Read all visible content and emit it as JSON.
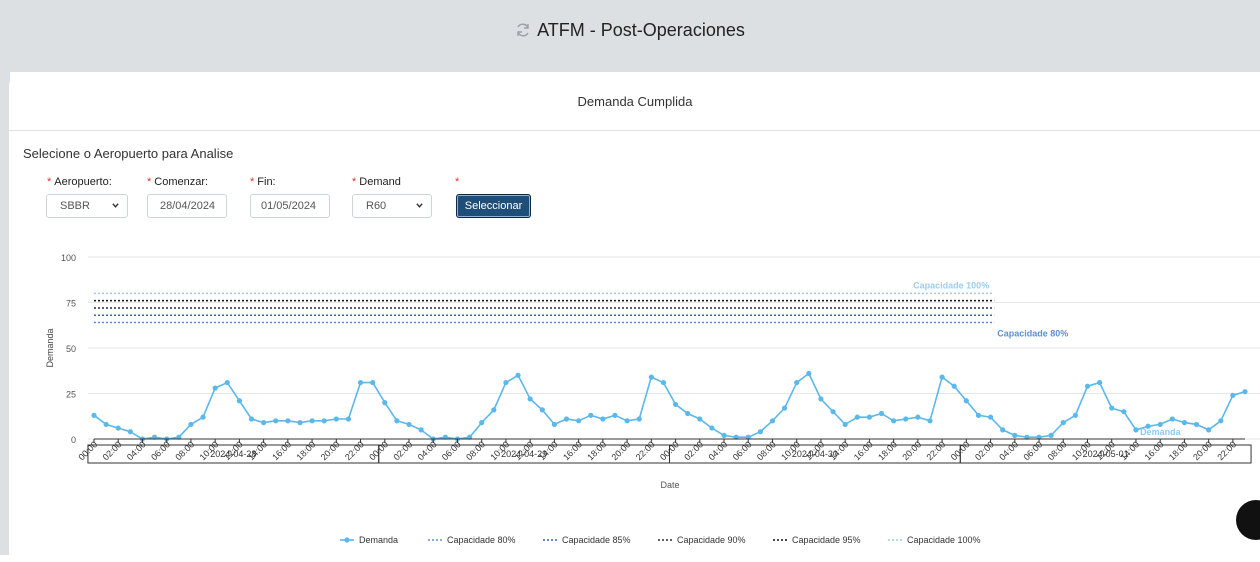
{
  "header": {
    "title": "ATFM - Post-Operaciones",
    "icon": "refresh-icon"
  },
  "card": {
    "title": "Demanda Cumplida"
  },
  "form": {
    "section_title": "Selecione o Aeropuerto para Analise",
    "airport": {
      "label": "Aeropuerto:",
      "value": "SBBR"
    },
    "start": {
      "label": "Comenzar:",
      "value": "28/04/2024"
    },
    "end": {
      "label": "Fin:",
      "value": "01/05/2024"
    },
    "demand": {
      "label": "Demand",
      "value": "R60"
    },
    "submit_label": "Seleccionar",
    "required_mark": "*"
  },
  "chart_data": {
    "type": "line",
    "xlabel": "Date",
    "ylabel": "Demanda",
    "ylim": [
      0,
      100
    ],
    "yticks": [
      0,
      25,
      50,
      75,
      100
    ],
    "days": [
      "2024-04-28",
      "2024-04-29",
      "2024-04-30",
      "2024-05-01"
    ],
    "hour_labels": [
      "00:00",
      "02:00",
      "04:00",
      "06:00",
      "08:00",
      "10:00",
      "12:00",
      "14:00",
      "16:00",
      "18:00",
      "20:00",
      "22:00"
    ],
    "series": [
      {
        "name": "Demanda",
        "type": "line",
        "color": "#5bb8ea",
        "values": [
          13,
          8,
          6,
          4,
          0,
          1,
          0,
          1,
          8,
          12,
          28,
          31,
          21,
          11,
          9,
          10,
          10,
          9,
          10,
          10,
          11,
          11,
          31,
          31,
          20,
          10,
          8,
          5,
          0,
          1,
          0,
          1,
          9,
          16,
          31,
          35,
          22,
          16,
          8,
          11,
          10,
          13,
          11,
          13,
          10,
          11,
          34,
          31,
          19,
          14,
          11,
          6,
          2,
          1,
          1,
          4,
          10,
          17,
          31,
          36,
          22,
          15,
          8,
          12,
          12,
          14,
          10,
          11,
          12,
          10,
          34,
          29,
          21,
          13,
          12,
          5,
          2,
          1,
          1,
          2,
          9,
          13,
          29,
          31,
          17,
          15,
          5,
          7,
          8,
          11,
          9,
          8,
          5,
          10,
          24,
          26
        ]
      },
      {
        "name": "Capacidade 80%",
        "type": "hline",
        "value": 64,
        "color": "#5b8fd9"
      },
      {
        "name": "Capacidade 85%",
        "type": "hline",
        "value": 68,
        "color": "#3366bb"
      },
      {
        "name": "Capacidade 90%",
        "type": "hline",
        "value": 72,
        "color": "#1a2e55"
      },
      {
        "name": "Capacidade 95%",
        "type": "hline",
        "value": 76,
        "color": "#111111"
      },
      {
        "name": "Capacidade 100%",
        "type": "hline",
        "value": 80,
        "color": "#9ccdf0"
      }
    ],
    "annotations": [
      "Capacidade 100%",
      "Capacidade 80%",
      "Demanda"
    ],
    "legend_position": "bottom"
  }
}
